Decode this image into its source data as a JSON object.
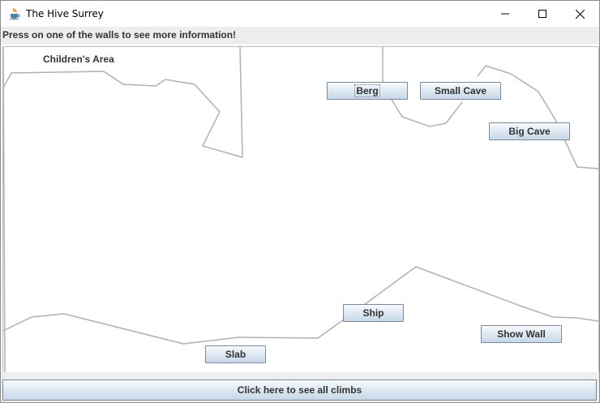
{
  "window": {
    "title": "The Hive Surrey",
    "icon": "java-coffee-cup-icon",
    "controls": [
      "minimize-icon",
      "maximize-icon",
      "close-icon"
    ]
  },
  "instructions": "Press on one of the walls to see more information!",
  "map": {
    "area_label": "Children's Area",
    "walls": {
      "berg": "Berg",
      "small_cave": "Small Cave",
      "big_cave": "Big Cave",
      "ship": "Ship",
      "slab": "Slab",
      "show_wall": "Show Wall"
    },
    "wall_outline_color": "#b0b0b0"
  },
  "footer": {
    "all_climbs_label": "Click here to see all climbs"
  }
}
